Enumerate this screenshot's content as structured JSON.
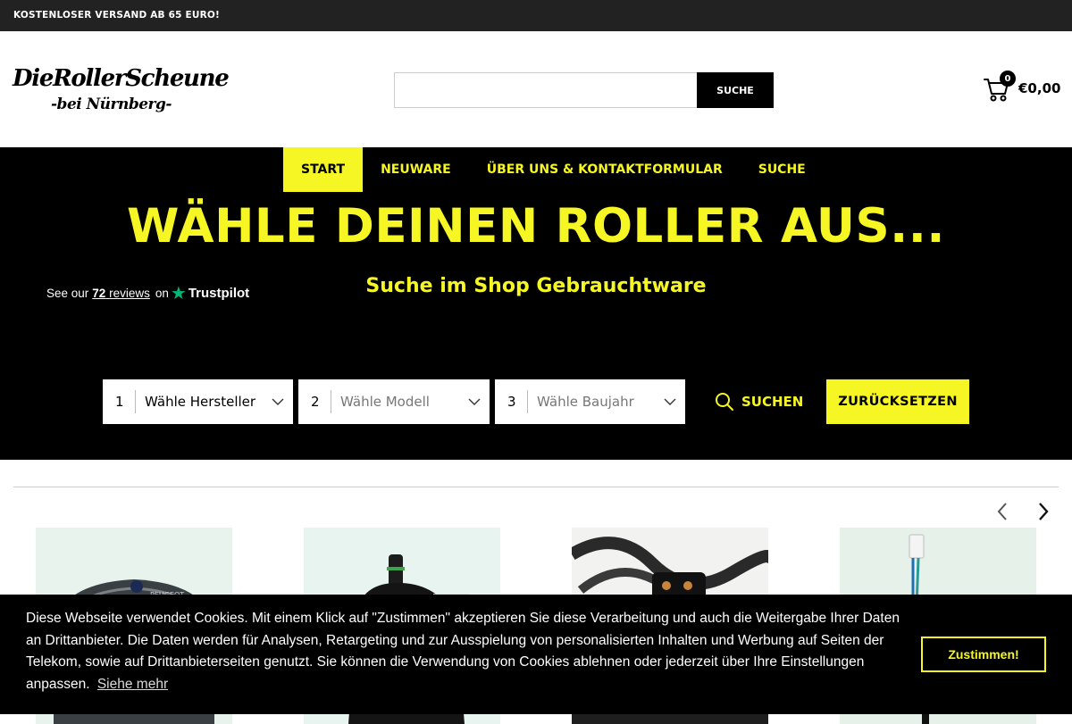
{
  "topbar": {
    "text": "KOSTENLOSER VERSAND AB 65 EURO!"
  },
  "header": {
    "logo_line1": "DieRollerScheune",
    "logo_line2": "-bei Nürnberg-",
    "search_placeholder": "",
    "search_button": "SUCHE",
    "cart_count": "0",
    "cart_total": "€0,00"
  },
  "nav": [
    {
      "label": "START",
      "active": true
    },
    {
      "label": "NEUWARE"
    },
    {
      "label": "ÜBER UNS & KONTAKTFORMULAR"
    },
    {
      "label": "SUCHE"
    }
  ],
  "hero": {
    "title": "WÄHLE DEINEN ROLLER AUS...",
    "subtitle": "Suche im Shop Gebrauchtware"
  },
  "trustpilot": {
    "prefix": "See our",
    "count": "72",
    "reviews": "reviews",
    "on": "on",
    "brand": "Trustpilot"
  },
  "finder": {
    "manufacturer": {
      "num": "1",
      "label": "Wähle Hersteller"
    },
    "model": {
      "num": "2",
      "label": "Wähle Modell"
    },
    "year": {
      "num": "3",
      "label": "Wähle Baujahr"
    },
    "search_label": "SUCHEN",
    "reset_label": "ZURÜCKSETZEN"
  },
  "products": [
    {
      "name": "speedometer-product"
    },
    {
      "name": "brake-caliper-product"
    },
    {
      "name": "wiring-harness-product"
    },
    {
      "name": "cable-connector-product"
    }
  ],
  "cookie": {
    "text": "Diese Webseite verwendet Cookies. Mit einem Klick auf \"Zustimmen\" akzeptieren Sie diese Verarbeitung und auch die Weitergabe Ihrer Daten an Drittanbieter. Die Daten werden für Analysen, Retargeting und zur Ausspielung von personalisierten Inhalten und Werbung auf Seiten der Telekom, sowie auf Drittanbieterseiten genutzt. Sie können die Verwendung von Cookies ablehnen oder jederzeit über Ihre Einstellungen anpassen.",
    "more_label": "Siehe mehr",
    "accept_label": "Zustimmen!"
  },
  "colors": {
    "accent": "#f6f624",
    "dark": "#000000",
    "topbar": "#222222"
  }
}
